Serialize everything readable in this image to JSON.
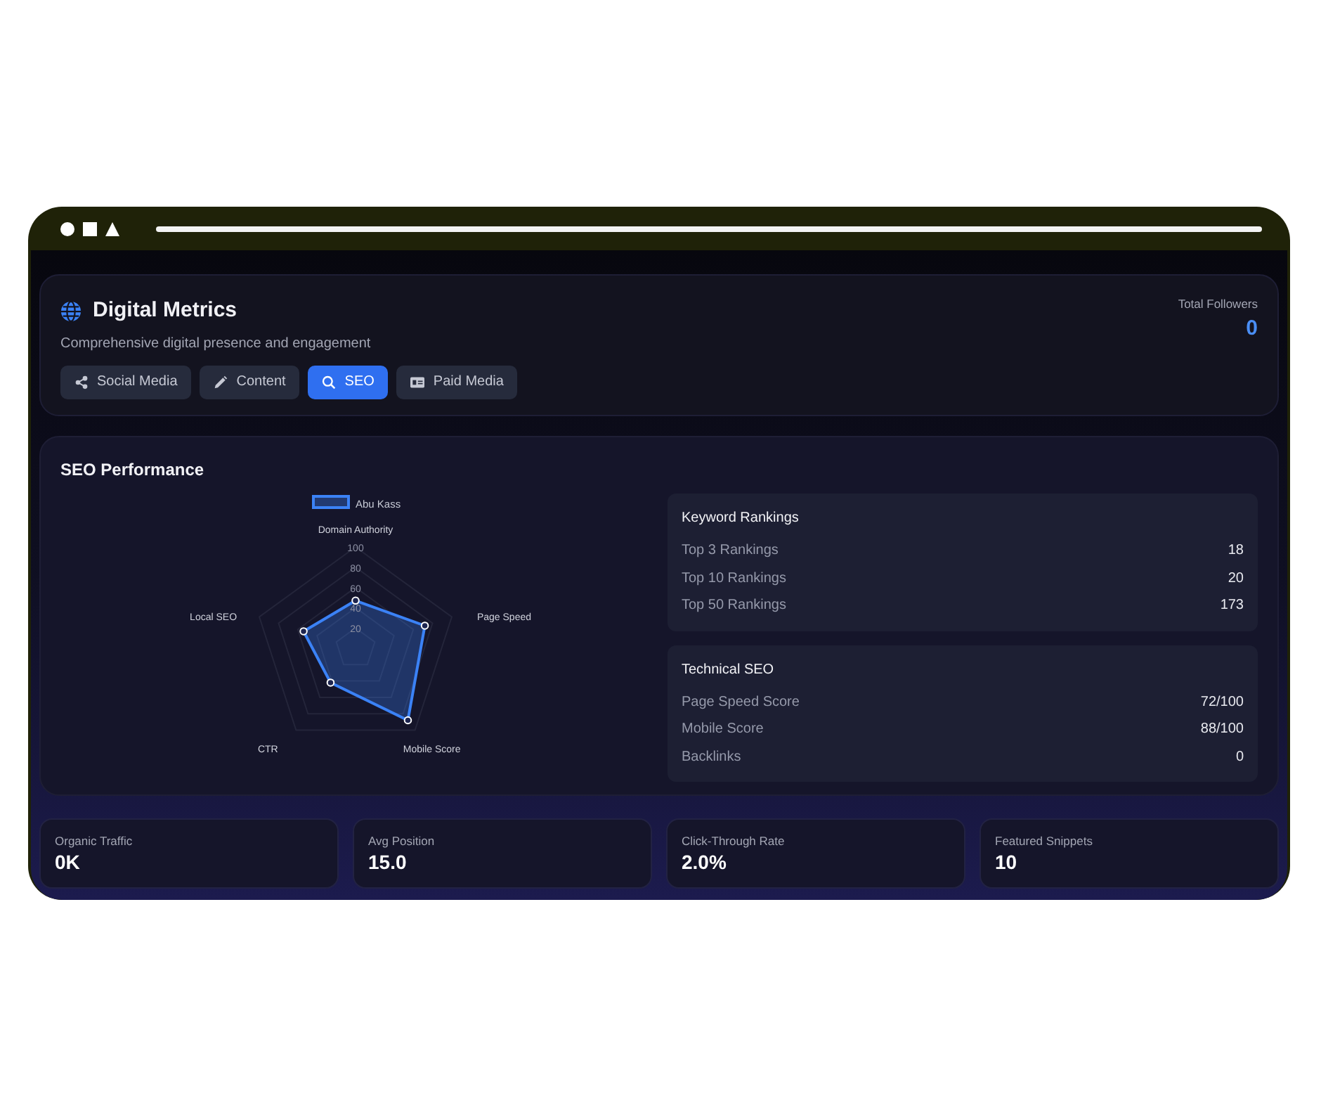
{
  "header": {
    "title": "Digital Metrics",
    "subtitle": "Comprehensive digital presence and engagement",
    "followers_label": "Total Followers",
    "followers_value": "0"
  },
  "tabs": [
    {
      "label": "Social Media",
      "kind": "share",
      "selected": false
    },
    {
      "label": "Content",
      "kind": "pencil",
      "selected": false
    },
    {
      "label": "SEO",
      "kind": "search",
      "selected": true
    },
    {
      "label": "Paid Media",
      "kind": "card",
      "selected": false
    }
  ],
  "seo": {
    "title": "SEO Performance",
    "chart_data": {
      "type": "radar",
      "categories": [
        "Domain Authority",
        "Page Speed",
        "Mobile Score",
        "CTR",
        "Local SEO"
      ],
      "series": [
        {
          "name": "Abu Kass",
          "color": "#3b82f6",
          "values": [
            47,
            72,
            88,
            42,
            54
          ]
        }
      ],
      "ylim": [
        0,
        100
      ],
      "yticks": [
        20,
        40,
        60,
        80,
        100
      ]
    },
    "panels": [
      {
        "title": "Keyword Rankings",
        "rows": [
          {
            "label": "Top 3 Rankings",
            "value": "18"
          },
          {
            "label": "Top 10 Rankings",
            "value": "20"
          },
          {
            "label": "Top 50 Rankings",
            "value": "173"
          }
        ]
      },
      {
        "title": "Technical SEO",
        "rows": [
          {
            "label": "Page Speed Score",
            "value": "72/100"
          },
          {
            "label": "Mobile Score",
            "value": "88/100"
          },
          {
            "label": "Backlinks",
            "value": "0"
          }
        ]
      }
    ]
  },
  "stats": [
    {
      "label": "Organic Traffic",
      "value": "0K"
    },
    {
      "label": "Avg Position",
      "value": "15.0"
    },
    {
      "label": "Click-Through Rate",
      "value": "2.0%"
    },
    {
      "label": "Featured Snippets",
      "value": "10"
    }
  ]
}
